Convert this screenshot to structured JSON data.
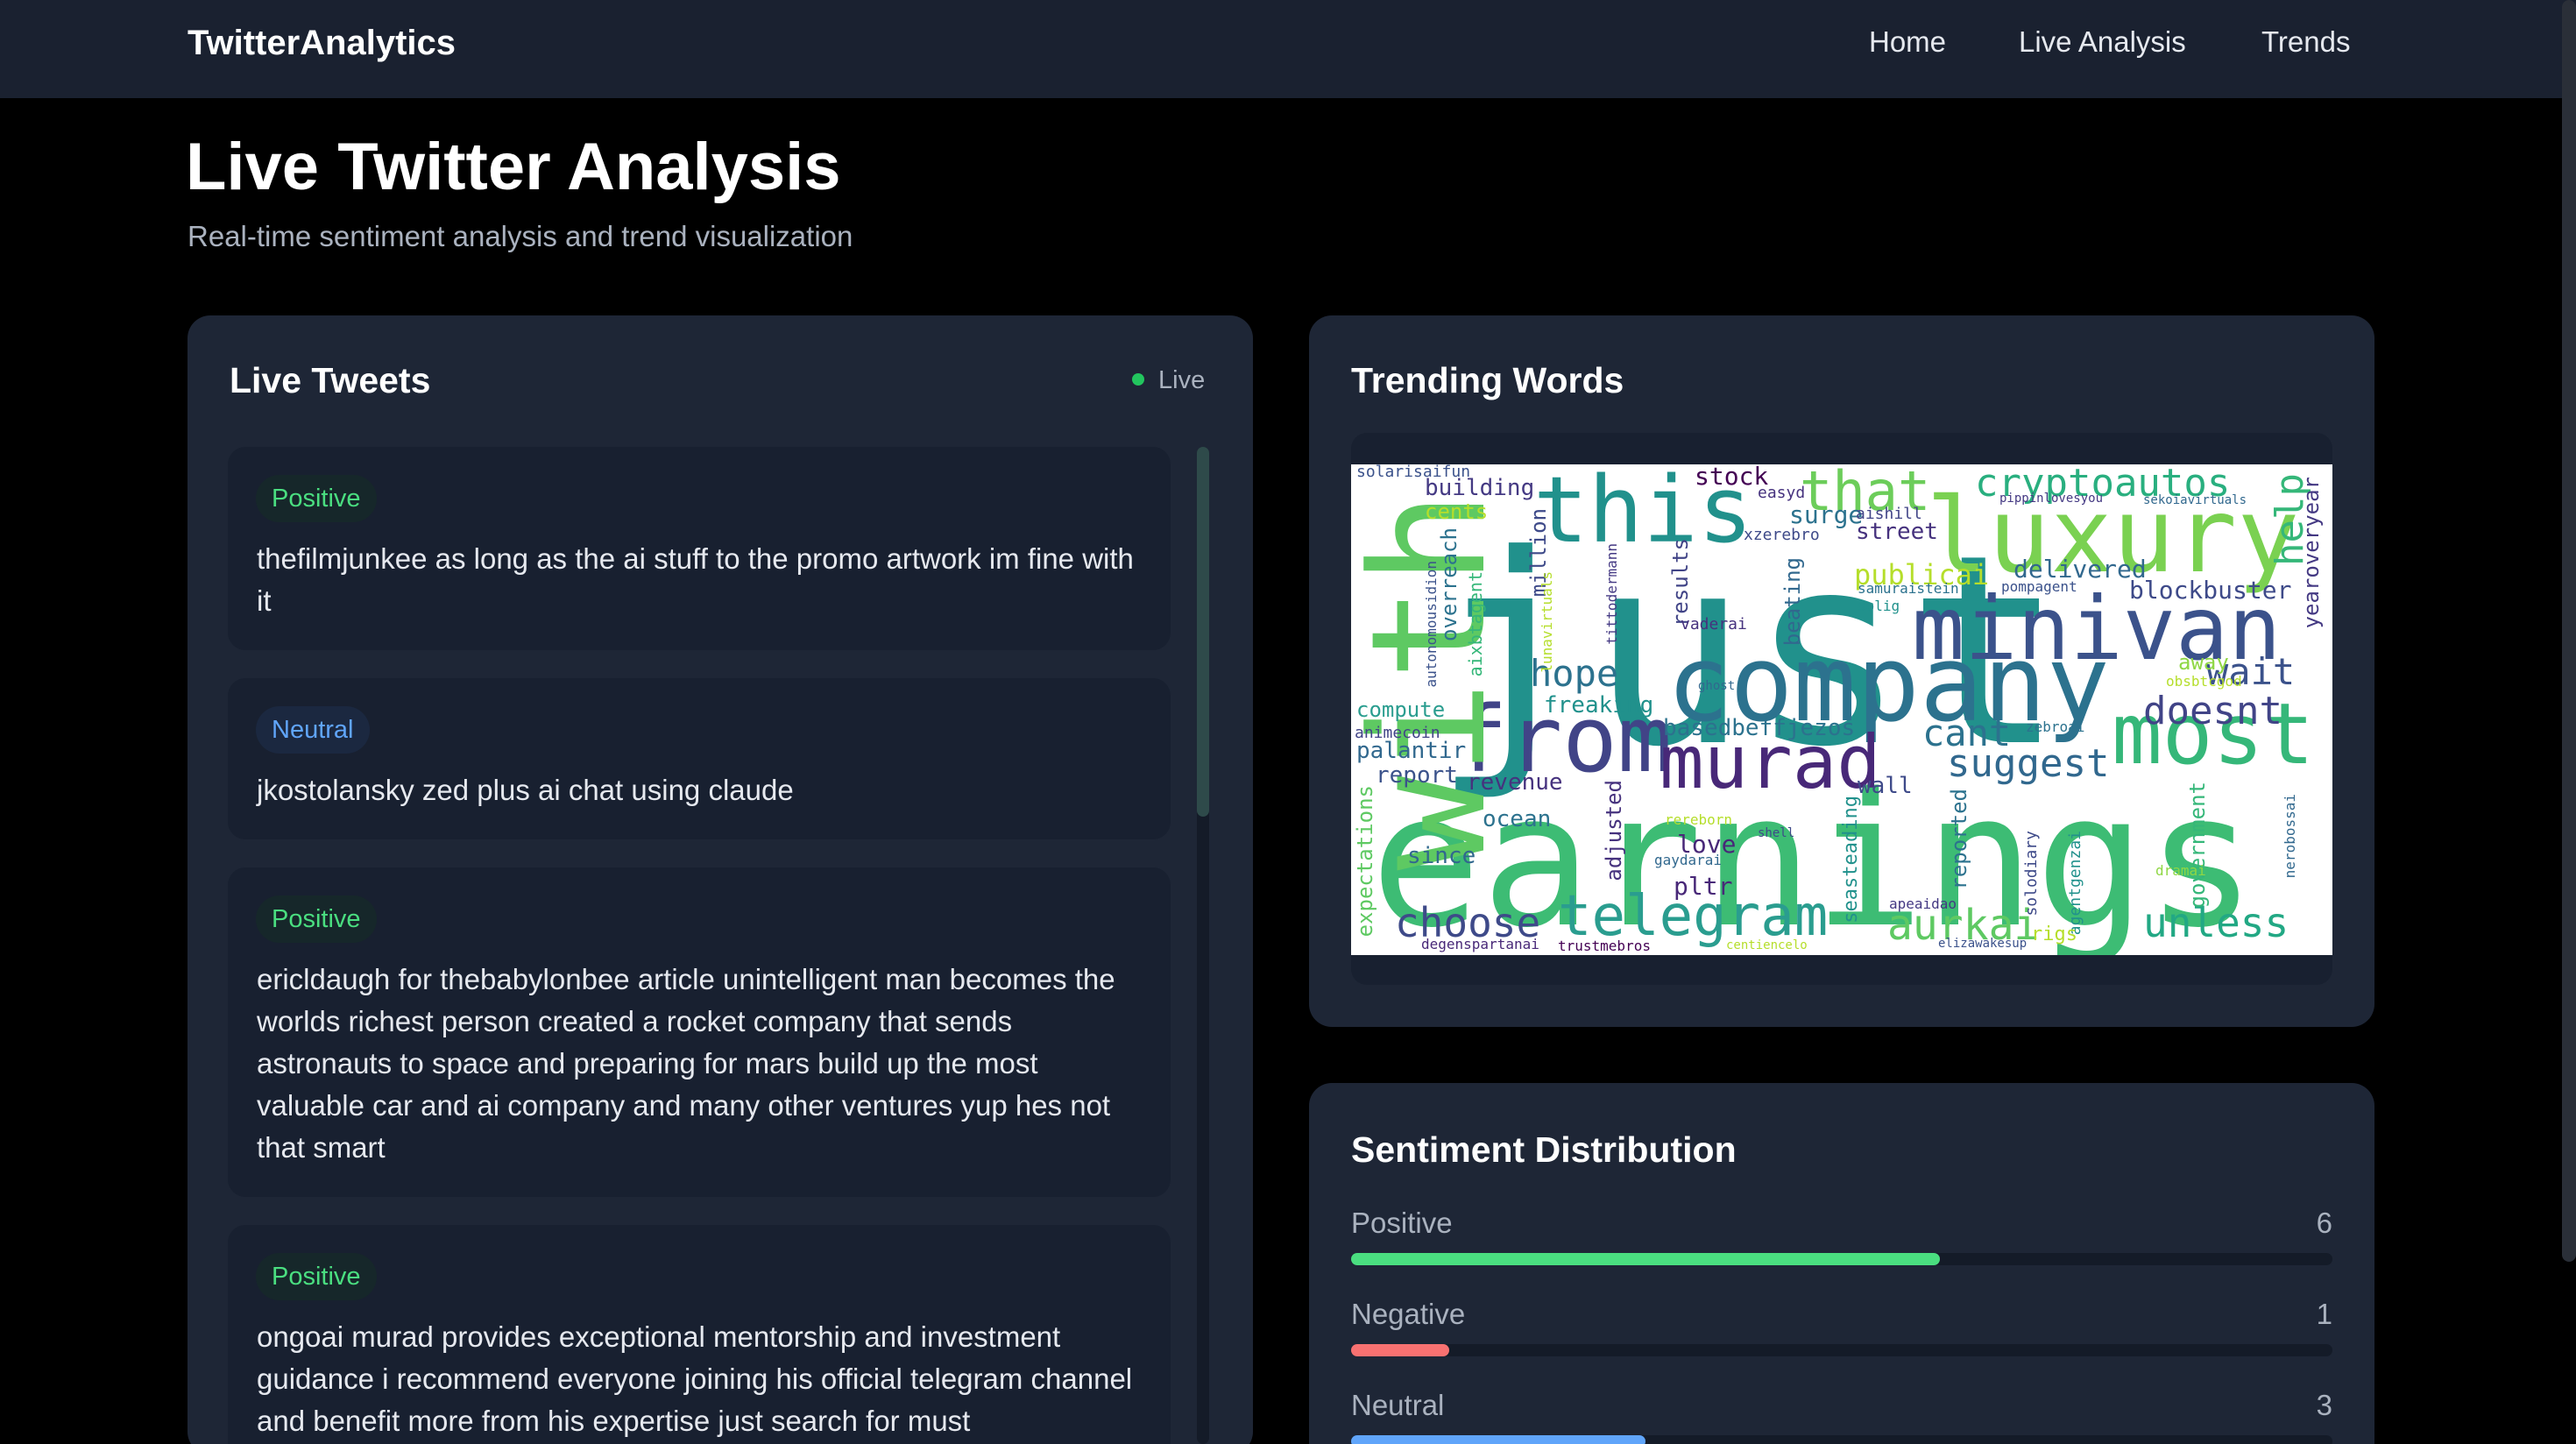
{
  "nav": {
    "brand": "TwitterAnalytics",
    "links": [
      "Home",
      "Live Analysis",
      "Trends"
    ]
  },
  "header": {
    "title": "Live Twitter Analysis",
    "subtitle": "Real-time sentiment analysis and trend visualization"
  },
  "live_tweets": {
    "title": "Live Tweets",
    "status": "Live",
    "tweets": [
      {
        "sentiment": "Positive",
        "text": "thefilmjunkee as long as the ai stuff to the promo artwork im fine with it"
      },
      {
        "sentiment": "Neutral",
        "text": "jkostolansky zed plus ai chat using claude"
      },
      {
        "sentiment": "Positive",
        "text": "ericldaugh for thebabylonbee article unintelligent man becomes the worlds richest person created a rocket company that sends astronauts to space and preparing for mars build up the most valuable car and ai company and many other ventures yup hes not that smart"
      },
      {
        "sentiment": "Positive",
        "text": "ongoai murad provides exceptional mentorship and investment guidance i recommend everyone joining his official telegram channel and benefit more from his expertise just search for must"
      }
    ]
  },
  "trending": {
    "title": "Trending Words",
    "words": [
      {
        "text": "just",
        "color": "#21918c",
        "vertical": false
      },
      {
        "text": "earnings",
        "color": "#3dbc74",
        "vertical": false
      },
      {
        "text": "company",
        "color": "#2c728e",
        "vertical": false
      },
      {
        "text": "minivan",
        "color": "#3b528b",
        "vertical": false
      },
      {
        "text": "luxury",
        "color": "#7ad151",
        "vertical": false
      },
      {
        "text": "from",
        "color": "#414487",
        "vertical": false
      },
      {
        "text": "murad",
        "color": "#482878",
        "vertical": false
      },
      {
        "text": "most",
        "color": "#35b779",
        "vertical": false
      },
      {
        "text": "this",
        "color": "#21918c",
        "vertical": false
      },
      {
        "text": "telegram",
        "color": "#2a9d8f",
        "vertical": false
      },
      {
        "text": "with",
        "color": "#5ec962",
        "vertical": true
      },
      {
        "text": "that",
        "color": "#6ccd5a",
        "vertical": false
      },
      {
        "text": "cryptoautos",
        "color": "#29af7f",
        "vertical": false
      },
      {
        "text": "choose",
        "color": "#3e4a89",
        "vertical": false
      },
      {
        "text": "aurkai",
        "color": "#5ec962",
        "vertical": false
      },
      {
        "text": "unless",
        "color": "#22a884",
        "vertical": false
      },
      {
        "text": "suggest",
        "color": "#31688e",
        "vertical": false
      },
      {
        "text": "doesnt",
        "color": "#414487",
        "vertical": false
      },
      {
        "text": "cant",
        "color": "#2c728e",
        "vertical": false
      },
      {
        "text": "wait",
        "color": "#3b528b",
        "vertical": false
      },
      {
        "text": "hope",
        "color": "#2c728e",
        "vertical": false
      },
      {
        "text": "help",
        "color": "#35b779",
        "vertical": true
      },
      {
        "text": "publicai",
        "color": "#b5de2b",
        "vertical": false
      },
      {
        "text": "delivered",
        "color": "#31688e",
        "vertical": false
      },
      {
        "text": "blockbuster",
        "color": "#3e4a89",
        "vertical": false
      },
      {
        "text": "building",
        "color": "#443983",
        "vertical": false
      },
      {
        "text": "stock",
        "color": "#440154",
        "vertical": false
      },
      {
        "text": "surge",
        "color": "#2c728e",
        "vertical": false
      },
      {
        "text": "street",
        "color": "#46327e",
        "vertical": false
      },
      {
        "text": "freaking",
        "color": "#21918c",
        "vertical": false
      },
      {
        "text": "compute",
        "color": "#2a9d8f",
        "vertical": false
      },
      {
        "text": "basedbeffjezos",
        "color": "#2c728e",
        "vertical": false
      },
      {
        "text": "palantir",
        "color": "#31688e",
        "vertical": false
      },
      {
        "text": "report",
        "color": "#3b528b",
        "vertical": false
      },
      {
        "text": "revenue",
        "color": "#46327e",
        "vertical": false
      },
      {
        "text": "wall",
        "color": "#3e4a89",
        "vertical": false
      },
      {
        "text": "ocean",
        "color": "#2c728e",
        "vertical": false
      },
      {
        "text": "love",
        "color": "#482878",
        "vertical": false
      },
      {
        "text": "since",
        "color": "#31688e",
        "vertical": false
      },
      {
        "text": "pltr",
        "color": "#482878",
        "vertical": false
      },
      {
        "text": "away",
        "color": "#8fd744",
        "vertical": false
      },
      {
        "text": "cents",
        "color": "#b5de2b",
        "vertical": false
      },
      {
        "text": "yearoveryear",
        "color": "#443983",
        "vertical": true
      },
      {
        "text": "government",
        "color": "#35b779",
        "vertical": true
      },
      {
        "text": "expectations",
        "color": "#5ec962",
        "vertical": true
      },
      {
        "text": "seasteading",
        "color": "#21918c",
        "vertical": true
      },
      {
        "text": "reported",
        "color": "#2c728e",
        "vertical": true
      },
      {
        "text": "adjusted",
        "color": "#46327e",
        "vertical": true
      },
      {
        "text": "million",
        "color": "#3e4a89",
        "vertical": true
      },
      {
        "text": "results",
        "color": "#414487",
        "vertical": true
      },
      {
        "text": "beating",
        "color": "#31688e",
        "vertical": true
      },
      {
        "text": "overreach",
        "color": "#2c728e",
        "vertical": true
      },
      {
        "text": "aixbtagent",
        "color": "#35b779",
        "vertical": true
      },
      {
        "text": "autonomousidion",
        "color": "#3b528b",
        "vertical": true
      },
      {
        "text": "lunavirtuals",
        "color": "#b5de2b",
        "vertical": true
      },
      {
        "text": "tittodermann",
        "color": "#443983",
        "vertical": true
      },
      {
        "text": "solodiary",
        "color": "#3e4a89",
        "vertical": true
      },
      {
        "text": "agentgenzai",
        "color": "#21918c",
        "vertical": true
      },
      {
        "text": "nerobossai",
        "color": "#31688e",
        "vertical": true
      },
      {
        "text": "solarisaifun",
        "color": "#3b528b",
        "vertical": false
      },
      {
        "text": "easyd",
        "color": "#46327e",
        "vertical": false
      },
      {
        "text": "xzerebro",
        "color": "#3e4a89",
        "vertical": false
      },
      {
        "text": "aishill",
        "color": "#414487",
        "vertical": false
      },
      {
        "text": "pippinlovesyou",
        "color": "#443983",
        "vertical": false
      },
      {
        "text": "sekoiavirtuals",
        "color": "#31688e",
        "vertical": false
      },
      {
        "text": "samuraistein",
        "color": "#2c728e",
        "vertical": false
      },
      {
        "text": "solig",
        "color": "#21918c",
        "vertical": false
      },
      {
        "text": "pompagent",
        "color": "#3b528b",
        "vertical": false
      },
      {
        "text": "vaderai",
        "color": "#46327e",
        "vertical": false
      },
      {
        "text": "obsbtcgod",
        "color": "#b5de2b",
        "vertical": false
      },
      {
        "text": "ghost",
        "color": "#31688e",
        "vertical": false
      },
      {
        "text": "animecoin",
        "color": "#414487",
        "vertical": false
      },
      {
        "text": "zebroai",
        "color": "#2c728e",
        "vertical": false
      },
      {
        "text": "rereborn",
        "color": "#b5de2b",
        "vertical": false
      },
      {
        "text": "shell",
        "color": "#3e4a89",
        "vertical": false
      },
      {
        "text": "gaydarai",
        "color": "#31688e",
        "vertical": false
      },
      {
        "text": "dramai",
        "color": "#8fd744",
        "vertical": false
      },
      {
        "text": "apeaidao",
        "color": "#443983",
        "vertical": false
      },
      {
        "text": "rigs",
        "color": "#b5de2b",
        "vertical": false
      },
      {
        "text": "elizawakesup",
        "color": "#3b528b",
        "vertical": false
      },
      {
        "text": "degenspartanai",
        "color": "#482878",
        "vertical": false
      },
      {
        "text": "trustmebros",
        "color": "#440154",
        "vertical": false
      },
      {
        "text": "centiencelo",
        "color": "#b5de2b",
        "vertical": false
      }
    ]
  },
  "sentiment": {
    "title": "Sentiment Distribution",
    "bars": [
      {
        "label": "Positive",
        "count": 6,
        "fraction": 0.6,
        "color": "#4ade80"
      },
      {
        "label": "Negative",
        "count": 1,
        "fraction": 0.1,
        "color": "#f87171"
      },
      {
        "label": "Neutral",
        "count": 3,
        "fraction": 0.3,
        "color": "#60a5fa"
      }
    ]
  }
}
